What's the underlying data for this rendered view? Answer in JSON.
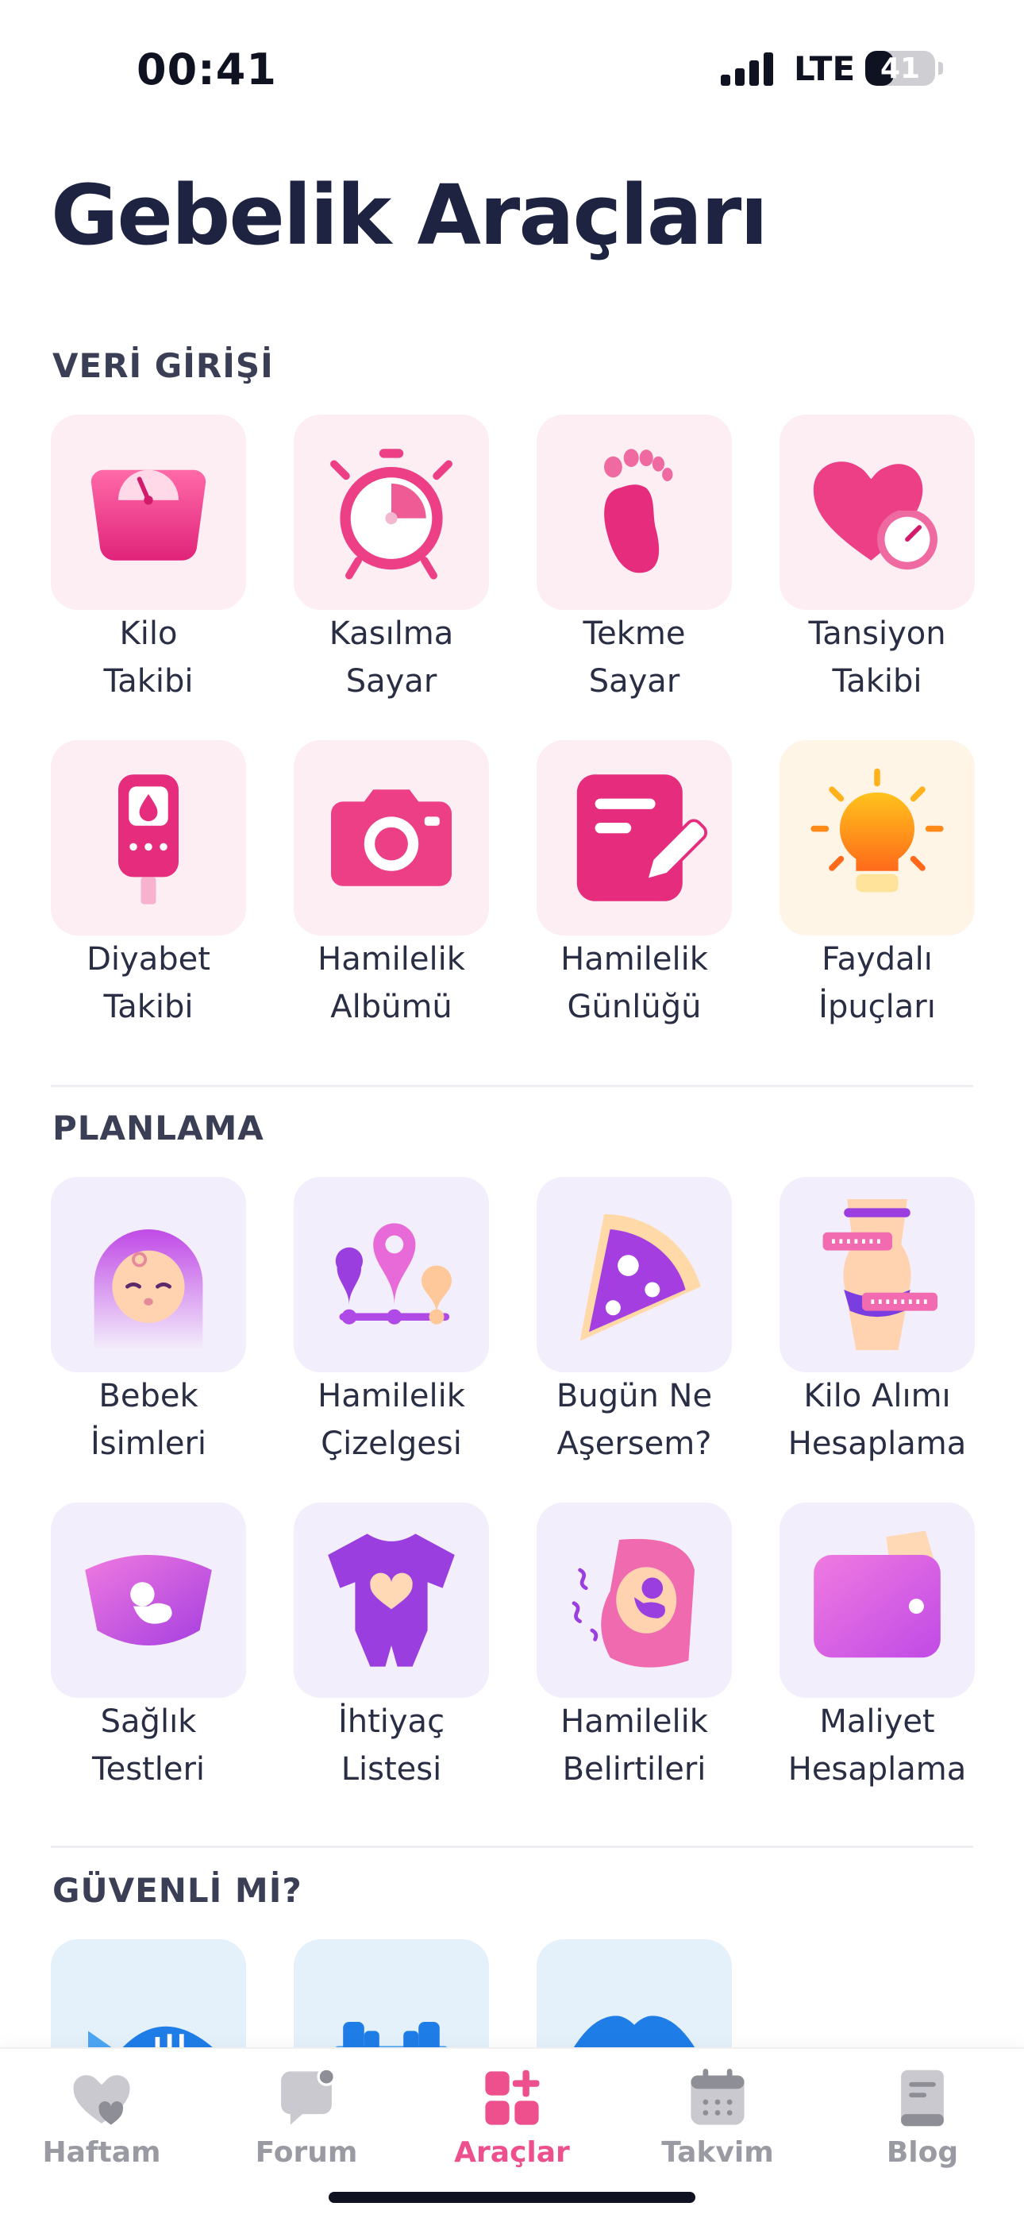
{
  "status_bar": {
    "time": "00:41",
    "network": "LTE",
    "battery": "41",
    "battery_level": 0.41
  },
  "page": {
    "title": "Gebelik Araçları"
  },
  "sections": {
    "data_entry": {
      "label": "VERİ GİRİŞİ",
      "items": [
        {
          "line1": "Kilo",
          "line2": "Takibi",
          "icon": "scale-icon"
        },
        {
          "line1": "Kasılma",
          "line2": "Sayar",
          "icon": "alarm-clock-icon"
        },
        {
          "line1": "Tekme",
          "line2": "Sayar",
          "icon": "footprint-icon"
        },
        {
          "line1": "Tansiyon",
          "line2": "Takibi",
          "icon": "heart-gauge-icon"
        },
        {
          "line1": "Diyabet",
          "line2": "Takibi",
          "icon": "glucose-meter-icon"
        },
        {
          "line1": "Hamilelik",
          "line2": "Albümü",
          "icon": "camera-icon"
        },
        {
          "line1": "Hamilelik",
          "line2": "Günlüğü",
          "icon": "journal-edit-icon"
        },
        {
          "line1": "Faydalı",
          "line2": "İpuçları",
          "icon": "light-bulb-icon"
        }
      ]
    },
    "planning": {
      "label": "PLANLAMA",
      "items": [
        {
          "line1": "Bebek",
          "line2": "İsimleri",
          "icon": "baby-icon"
        },
        {
          "line1": "Hamilelik",
          "line2": "Çizelgesi",
          "icon": "timeline-pins-icon"
        },
        {
          "line1": "Bugün Ne",
          "line2": "Aşersem?",
          "icon": "pizza-icon"
        },
        {
          "line1": "Kilo Alımı",
          "line2": "Hesaplama",
          "icon": "body-measure-icon"
        },
        {
          "line1": "Sağlık",
          "line2": "Testleri",
          "icon": "ultrasound-icon"
        },
        {
          "line1": "İhtiyaç",
          "line2": "Listesi",
          "icon": "baby-onesie-icon"
        },
        {
          "line1": "Hamilelik",
          "line2": "Belirtileri",
          "icon": "pregnant-belly-icon"
        },
        {
          "line1": "Maliyet",
          "line2": "Hesaplama",
          "icon": "wallet-icon"
        }
      ]
    },
    "is_safe": {
      "label": "GÜVENLİ Mİ?",
      "items": [
        {
          "icon": "fish-icon"
        },
        {
          "icon": "dumbbell-icon"
        },
        {
          "icon": "lips-icon"
        }
      ]
    }
  },
  "nav": {
    "items": [
      {
        "label": "Haftam",
        "icon": "heart-nav-icon",
        "active": false
      },
      {
        "label": "Forum",
        "icon": "chat-bubble-icon",
        "active": false
      },
      {
        "label": "Araçlar",
        "icon": "tools-grid-icon",
        "active": true
      },
      {
        "label": "Takvim",
        "icon": "calendar-icon",
        "active": false
      },
      {
        "label": "Blog",
        "icon": "blog-book-icon",
        "active": false
      }
    ]
  },
  "colors": {
    "accent": "#ee4f8d",
    "title": "#1d2340",
    "inactive": "#9a9aa3",
    "purple": "#a24be8"
  }
}
